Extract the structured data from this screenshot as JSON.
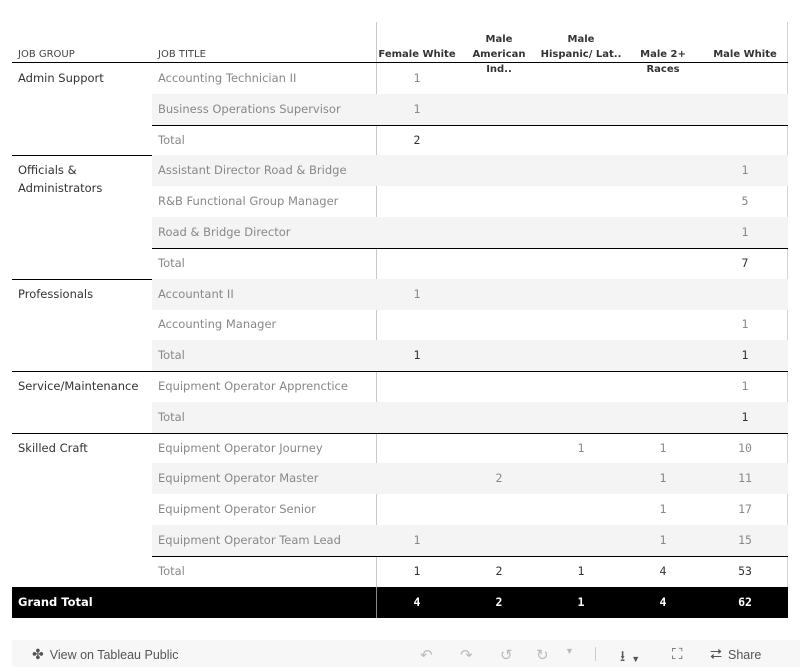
{
  "table": {
    "headers": {
      "job_group": "JOB GROUP",
      "job_title": "JOB TITLE",
      "columns": [
        {
          "line1": "",
          "line2": "Female  White"
        },
        {
          "line1": "Male",
          "line2": "American Ind.."
        },
        {
          "line1": "Male",
          "line2": "Hispanic/ Lat.."
        },
        {
          "line1": "",
          "line2": "Male 2+ Races"
        },
        {
          "line1": "",
          "line2": "Male White"
        }
      ]
    },
    "groups": [
      {
        "name": "Admin Support",
        "rows": [
          {
            "title": "Accounting Technician II",
            "values": [
              "1",
              "",
              "",
              "",
              ""
            ]
          },
          {
            "title": "Business Operations Supervisor",
            "values": [
              "1",
              "",
              "",
              "",
              ""
            ]
          }
        ],
        "total": {
          "title": "Total",
          "values": [
            "2",
            "",
            "",
            "",
            ""
          ]
        }
      },
      {
        "name": "Officials & Administrators",
        "rows": [
          {
            "title": "Assistant Director Road & Bridge",
            "values": [
              "",
              "",
              "",
              "",
              "1"
            ]
          },
          {
            "title": "R&B Functional Group Manager",
            "values": [
              "",
              "",
              "",
              "",
              "5"
            ]
          },
          {
            "title": "Road & Bridge Director",
            "values": [
              "",
              "",
              "",
              "",
              "1"
            ]
          }
        ],
        "total": {
          "title": "Total",
          "values": [
            "",
            "",
            "",
            "",
            "7"
          ]
        }
      },
      {
        "name": "Professionals",
        "rows": [
          {
            "title": "Accountant II",
            "values": [
              "1",
              "",
              "",
              "",
              ""
            ]
          },
          {
            "title": "Accounting Manager",
            "values": [
              "",
              "",
              "",
              "",
              "1"
            ]
          }
        ],
        "total": {
          "title": "Total",
          "values": [
            "1",
            "",
            "",
            "",
            "1"
          ]
        }
      },
      {
        "name": "Service/Maintenance",
        "rows": [
          {
            "title": "Equipment Operator Apprenctice",
            "values": [
              "",
              "",
              "",
              "",
              "1"
            ]
          }
        ],
        "total": {
          "title": "Total",
          "values": [
            "",
            "",
            "",
            "",
            "1"
          ]
        }
      },
      {
        "name": "Skilled Craft",
        "rows": [
          {
            "title": "Equipment Operator Journey",
            "values": [
              "",
              "",
              "1",
              "1",
              "10"
            ]
          },
          {
            "title": "Equipment Operator Master",
            "values": [
              "",
              "2",
              "",
              "1",
              "11"
            ]
          },
          {
            "title": "Equipment Operator Senior",
            "values": [
              "",
              "",
              "",
              "1",
              "17"
            ]
          },
          {
            "title": "Equipment Operator Team Lead",
            "values": [
              "1",
              "",
              "",
              "1",
              "15"
            ]
          }
        ],
        "total": {
          "title": "Total",
          "values": [
            "1",
            "2",
            "1",
            "4",
            "53"
          ]
        }
      }
    ],
    "grand_total": {
      "label": "Grand Total",
      "values": [
        "4",
        "2",
        "1",
        "4",
        "62"
      ]
    }
  },
  "toolbar": {
    "view_on_label": "View on Tableau Public",
    "share_label": "Share",
    "icons": [
      "tableau-logo-icon",
      "undo-icon",
      "redo-icon",
      "revert-icon",
      "refresh-icon",
      "dropdown-icon",
      "download-icon",
      "fullscreen-icon",
      "share-icon"
    ]
  }
}
